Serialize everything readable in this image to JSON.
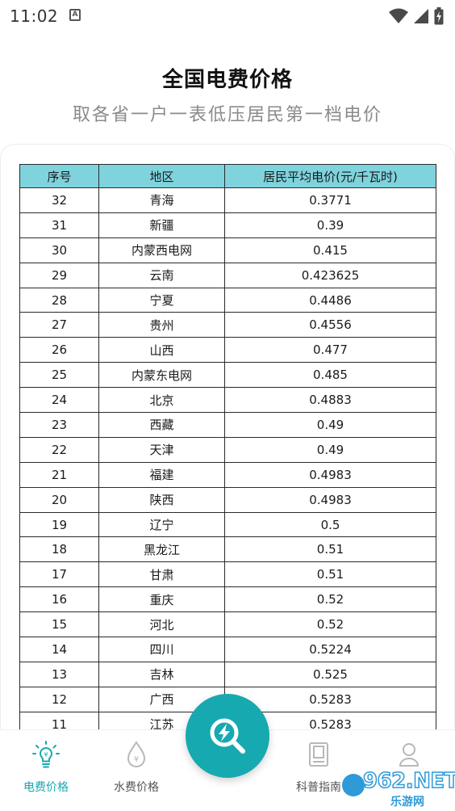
{
  "status_bar": {
    "time": "11:02",
    "app_icon_letter": "A",
    "icons": [
      "wifi-icon",
      "signal-icon",
      "battery-icon"
    ]
  },
  "header": {
    "title": "全国电费价格",
    "subtitle": "取各省一户一表低压居民第一档电价"
  },
  "table": {
    "header_color": "#7fd3dd",
    "columns": [
      "序号",
      "地区",
      "居民平均电价(元/千瓦时)"
    ],
    "rows": [
      {
        "no": "32",
        "region": "青海",
        "price": "0.3771"
      },
      {
        "no": "31",
        "region": "新疆",
        "price": "0.39"
      },
      {
        "no": "30",
        "region": "内蒙西电网",
        "price": "0.415"
      },
      {
        "no": "29",
        "region": "云南",
        "price": "0.423625"
      },
      {
        "no": "28",
        "region": "宁夏",
        "price": "0.4486"
      },
      {
        "no": "27",
        "region": "贵州",
        "price": "0.4556"
      },
      {
        "no": "26",
        "region": "山西",
        "price": "0.477"
      },
      {
        "no": "25",
        "region": "内蒙东电网",
        "price": "0.485"
      },
      {
        "no": "24",
        "region": "北京",
        "price": "0.4883"
      },
      {
        "no": "23",
        "region": "西藏",
        "price": "0.49"
      },
      {
        "no": "22",
        "region": "天津",
        "price": "0.49"
      },
      {
        "no": "21",
        "region": "福建",
        "price": "0.4983"
      },
      {
        "no": "20",
        "region": "陕西",
        "price": "0.4983"
      },
      {
        "no": "19",
        "region": "辽宁",
        "price": "0.5"
      },
      {
        "no": "18",
        "region": "黑龙江",
        "price": "0.51"
      },
      {
        "no": "17",
        "region": "甘肃",
        "price": "0.51"
      },
      {
        "no": "16",
        "region": "重庆",
        "price": "0.52"
      },
      {
        "no": "15",
        "region": "河北",
        "price": "0.52"
      },
      {
        "no": "14",
        "region": "四川",
        "price": "0.5224"
      },
      {
        "no": "13",
        "region": "吉林",
        "price": "0.525"
      },
      {
        "no": "12",
        "region": "广西",
        "price": "0.5283"
      },
      {
        "no": "11",
        "region": "江苏",
        "price": "0.5283"
      }
    ]
  },
  "tab_bar": {
    "accent_color": "#19a8b0",
    "tabs": [
      {
        "label": "电费价格",
        "icon": "lightbulb-icon",
        "active": true
      },
      {
        "label": "水费价格",
        "icon": "water-drop-icon",
        "active": false
      },
      {
        "label": "科普指南",
        "icon": "book-icon",
        "active": false
      },
      {
        "label": "",
        "icon": "person-icon",
        "active": false
      }
    ],
    "center_button_icon": "search-lightning-icon"
  },
  "watermark": {
    "text": "962.NET",
    "subtext": "乐游网"
  }
}
